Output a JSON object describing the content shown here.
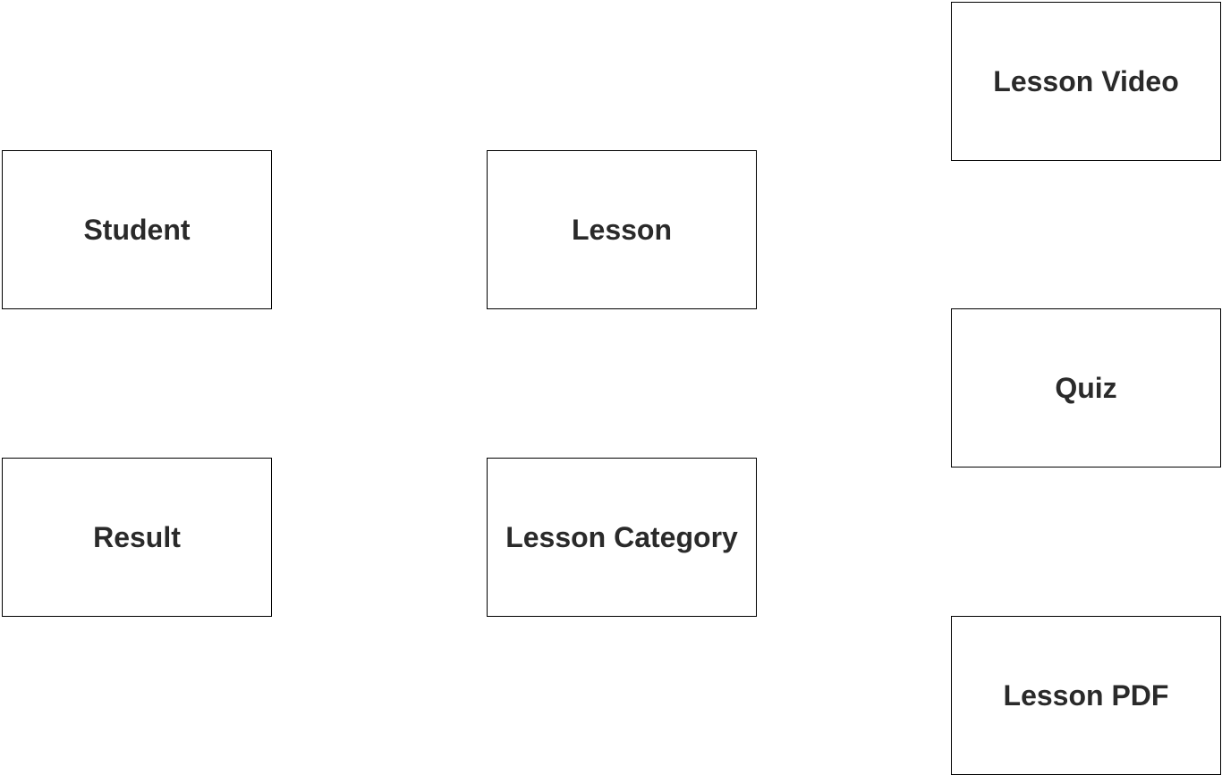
{
  "entities": [
    {
      "label": "Student"
    },
    {
      "label": "Lesson"
    },
    {
      "label": "Lesson Video"
    },
    {
      "label": "Quiz"
    },
    {
      "label": "Result"
    },
    {
      "label": "Lesson Category"
    },
    {
      "label": "Lesson PDF"
    }
  ],
  "colors": {
    "border": "#000000",
    "text": "#2a2a2a",
    "background": "#ffffff"
  }
}
